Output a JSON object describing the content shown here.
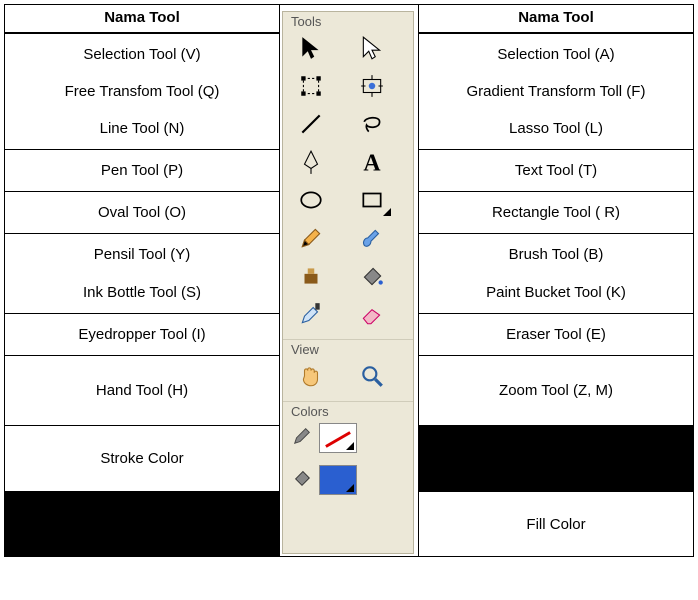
{
  "headers": {
    "left": "Nama Tool",
    "right": "Nama Tool"
  },
  "left": {
    "r1a": "Selection Tool (V)",
    "r1b": "Free Transfom Tool (Q)",
    "r1c": "Line Tool (N)",
    "r2": "Pen Tool (P)",
    "r3": "Oval Tool (O)",
    "r4a": "Pensil Tool (Y)",
    "r4b": "Ink Bottle Tool (S)",
    "r5": "Eyedropper Tool (I)",
    "r6": "Hand Tool (H)",
    "r7": "Stroke  Color"
  },
  "right": {
    "r1a": "Selection Tool (A)",
    "r1b": "Gradient Transform Toll (F)",
    "r1c": "Lasso Tool (L)",
    "r2": "Text Tool (T)",
    "r3": "Rectangle Tool  ( R)",
    "r4a": "Brush Tool (B)",
    "r4b": "Paint Bucket Tool (K)",
    "r5": "Eraser Tool (E)",
    "r6": "Zoom Tool (Z, M)",
    "r8": "Fill Color"
  },
  "toolbox": {
    "sections": {
      "tools": "Tools",
      "view": "View",
      "colors": "Colors"
    },
    "tools": [
      {
        "name": "selection-tool",
        "side": "left"
      },
      {
        "name": "subselection-tool",
        "side": "right"
      },
      {
        "name": "free-transform-tool",
        "side": "left"
      },
      {
        "name": "gradient-transform-tool",
        "side": "right"
      },
      {
        "name": "line-tool",
        "side": "left"
      },
      {
        "name": "lasso-tool",
        "side": "right"
      },
      {
        "name": "pen-tool",
        "side": "left"
      },
      {
        "name": "text-tool",
        "side": "right"
      },
      {
        "name": "oval-tool",
        "side": "left"
      },
      {
        "name": "rectangle-tool",
        "side": "right"
      },
      {
        "name": "pencil-tool",
        "side": "left"
      },
      {
        "name": "brush-tool",
        "side": "right"
      },
      {
        "name": "ink-bottle-tool",
        "side": "left"
      },
      {
        "name": "paint-bucket-tool",
        "side": "right"
      },
      {
        "name": "eyedropper-tool",
        "side": "left"
      },
      {
        "name": "eraser-tool",
        "side": "right"
      }
    ],
    "view": [
      {
        "name": "hand-tool"
      },
      {
        "name": "zoom-tool"
      }
    ],
    "colors": {
      "stroke_icon": "pencil-icon",
      "stroke_swatch": "none",
      "fill_icon": "bucket-icon",
      "fill_swatch": "#2a5fd0"
    }
  }
}
